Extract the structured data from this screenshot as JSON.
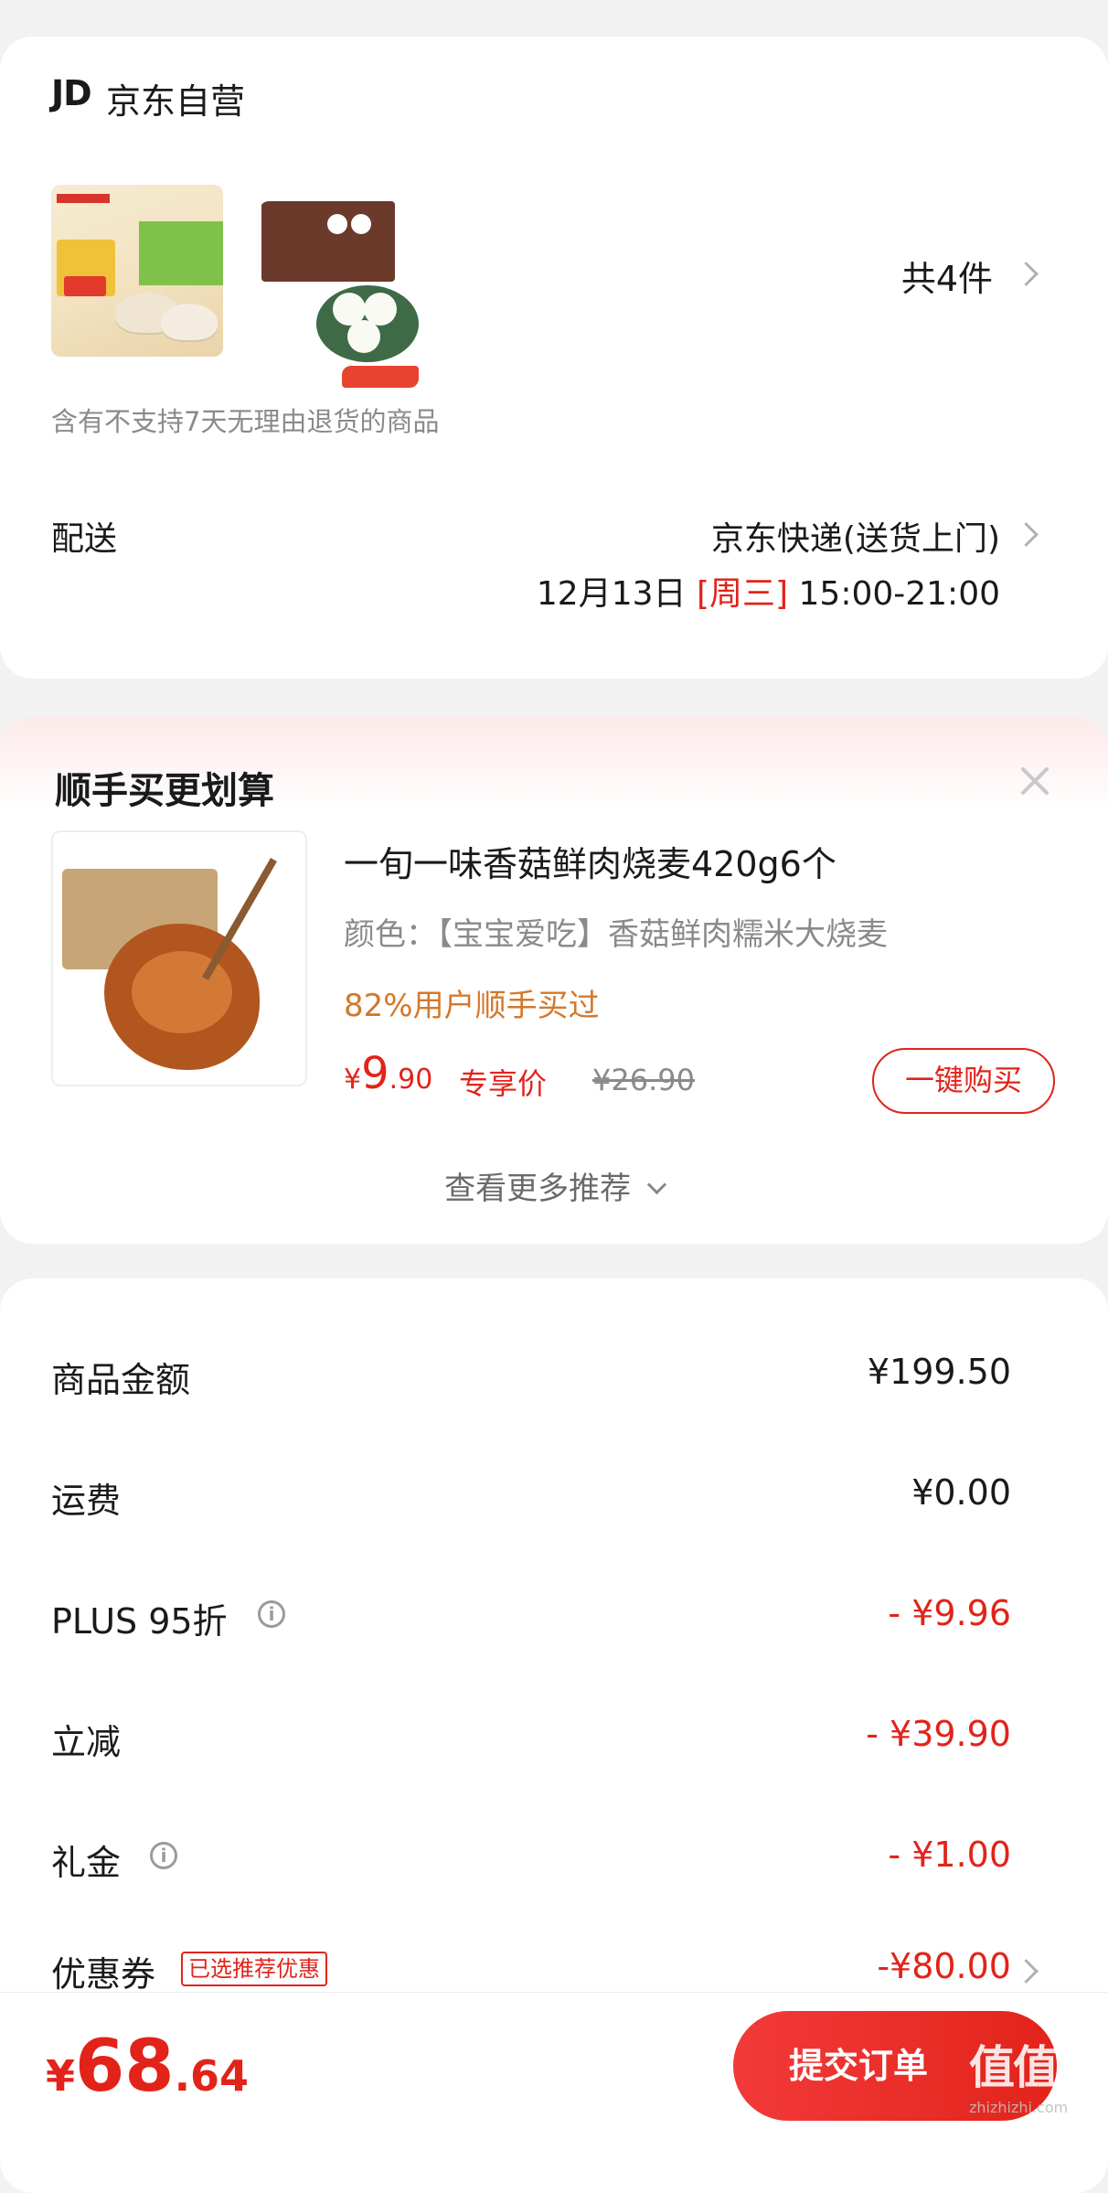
{
  "store": {
    "logo": "JD",
    "name": "京东自营",
    "item_count": "共4件",
    "notice": "含有不支持7天无理由退货的商品"
  },
  "delivery": {
    "label": "配送",
    "method": "京东快递(送货上门)",
    "date": "12月13日",
    "weekday": "[周三]",
    "time": "15:00-21:00"
  },
  "recommend": {
    "title": "顺手买更划算",
    "product": {
      "name": "一旬一味香菇鲜肉烧麦420g6个",
      "spec": "颜色：【宝宝爱吃】香菇鲜肉糯米大烧麦",
      "stat": "82%用户顺手买过",
      "price_symbol": "¥",
      "price_int": "9",
      "price_dec": ".90",
      "price_tag": "专享价",
      "orig_price": "¥26.90",
      "buy_label": "一键购买"
    },
    "more_label": "查看更多推荐"
  },
  "summary": {
    "rows": [
      {
        "label": "商品金额",
        "value": "¥199.50"
      },
      {
        "label": "运费",
        "value": "¥0.00"
      },
      {
        "label": "PLUS 95折",
        "value": "- ¥9.96"
      },
      {
        "label": "立减",
        "value": "- ¥39.90"
      },
      {
        "label": "礼金",
        "value": "- ¥1.00"
      },
      {
        "label": "优惠券",
        "badge": "已选推荐优惠",
        "value": "-¥80.00"
      }
    ]
  },
  "footer": {
    "total_symbol": "¥",
    "total_int": "68",
    "total_dec": ".64",
    "submit_label": "提交订单",
    "watermark": "值值值",
    "watermark_sub": "zhizhizhi.com"
  },
  "colors": {
    "accent": "#e2231a",
    "orange": "#d4782a",
    "bg": "#f2f2f2"
  }
}
